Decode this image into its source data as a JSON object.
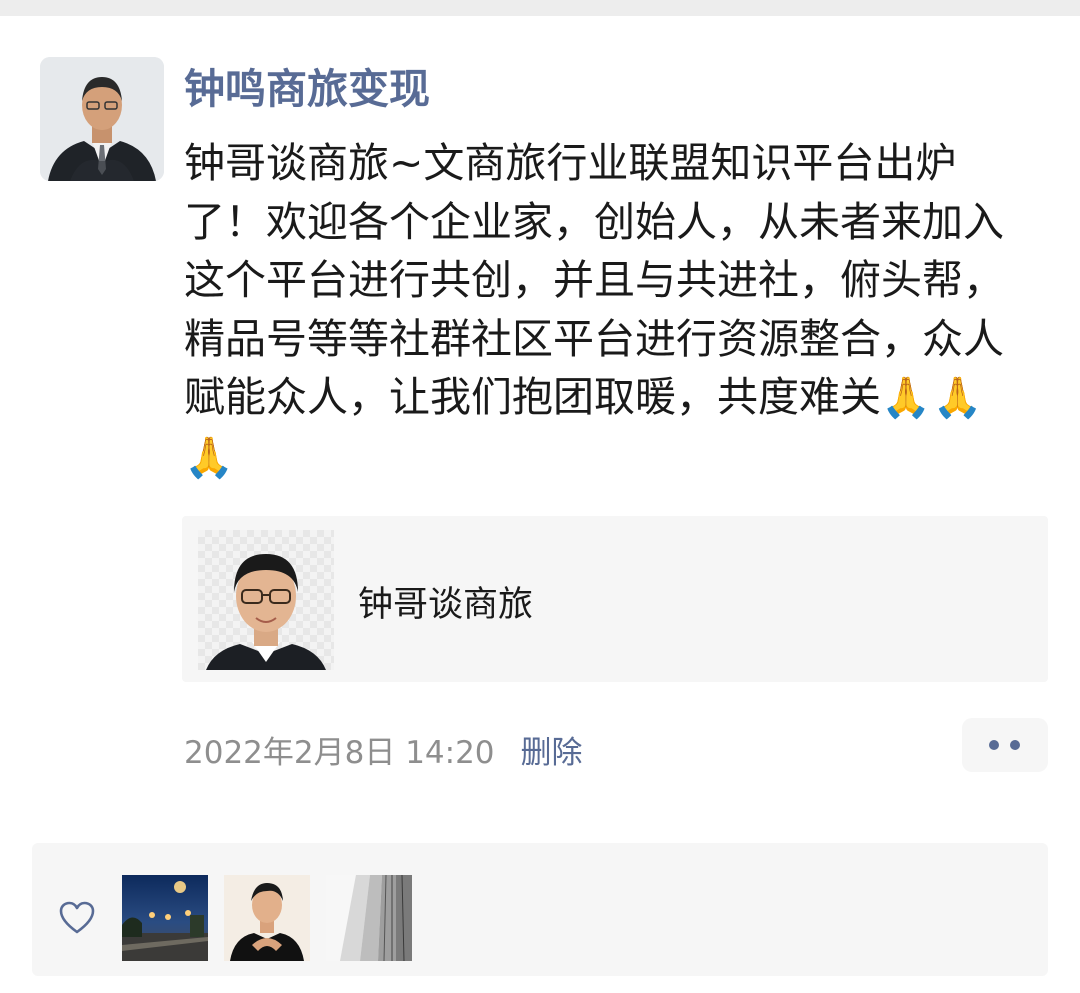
{
  "post": {
    "author": "钟鸣商旅变现",
    "text": "钟哥谈商旅~文商旅行业联盟知识平台出炉了！欢迎各个企业家，创始人，从未者来加入这个平台进行共创，并且与共进社，俯头帮，精品号等等社群社区平台进行资源整合，众人赋能众人，让我们抱团取暖，共度难关",
    "emojis": "🙏🙏🙏"
  },
  "card": {
    "title": "钟哥谈商旅"
  },
  "meta": {
    "timestamp": "2022年2月8日 14:20",
    "delete_label": "删除"
  },
  "icons": {
    "more": "more-dots-icon",
    "like": "heart-icon"
  },
  "colors": {
    "author_name": "#586b95",
    "link": "#586b95",
    "timestamp": "#8e8e8e",
    "panel_bg": "#f6f6f6"
  }
}
